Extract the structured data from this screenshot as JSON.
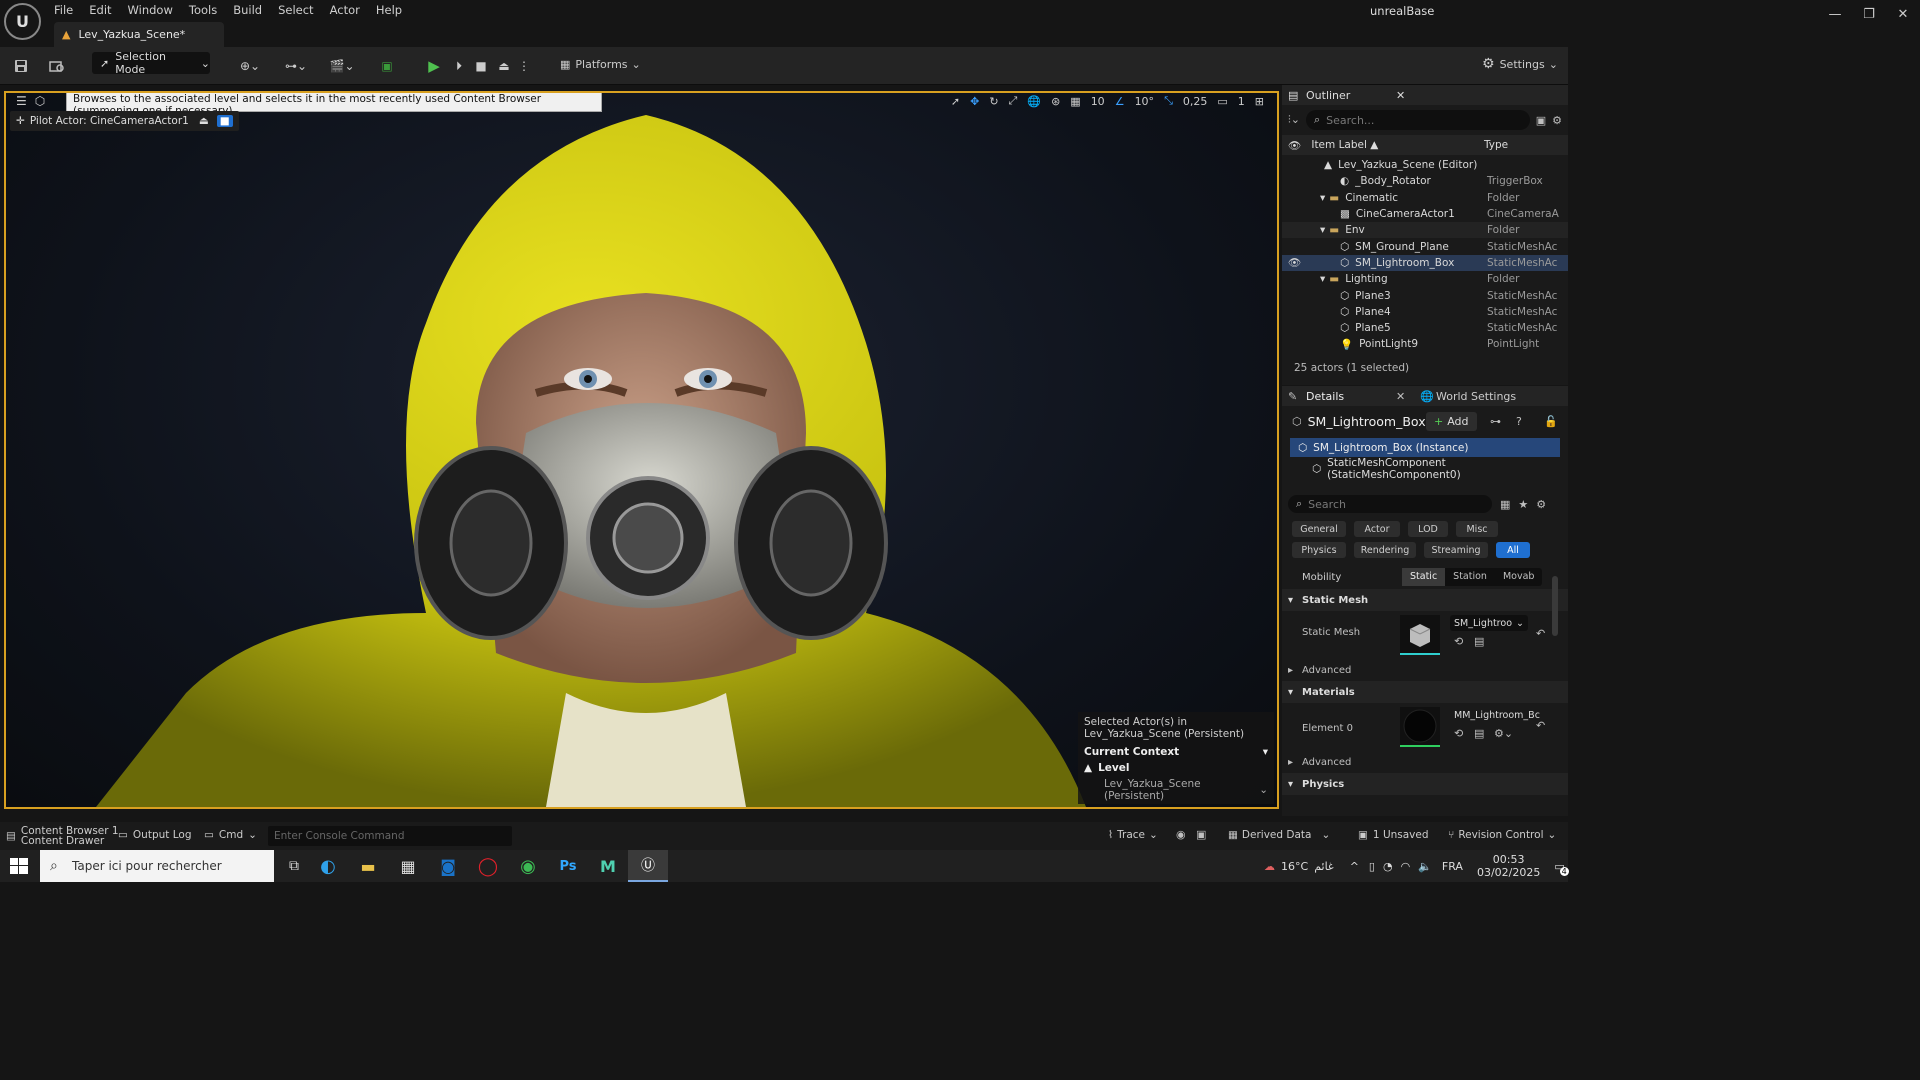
{
  "menu": [
    "File",
    "Edit",
    "Window",
    "Tools",
    "Build",
    "Select",
    "Actor",
    "Help"
  ],
  "tab_title": "Lev_Yazkua_Scene*",
  "project_name": "unrealBase",
  "toolbar": {
    "selection_mode": "Selection Mode",
    "platforms": "Platforms",
    "settings": "Settings"
  },
  "viewport": {
    "tooltip": "Browses to the associated level and selects it in the most recently used Content Browser (summoning one if necessary)",
    "pilot": "Pilot Actor: CineCameraActor1",
    "grid": "10",
    "angle": "10°",
    "scale": "0,25",
    "camera": "1",
    "context": {
      "selected_line1": "Selected Actor(s) in",
      "selected_line2": "Lev_Yazkua_Scene (Persistent)",
      "current_context": "Current Context",
      "level": "Level",
      "level_value": "Lev_Yazkua_Scene (Persistent)"
    }
  },
  "outliner": {
    "title": "Outliner",
    "search_placeholder": "Search...",
    "col_label": "Item Label ▲",
    "col_type": "Type",
    "rows": [
      {
        "label": "Lev_Yazkua_Scene (Editor)",
        "type": ""
      },
      {
        "label": "_Body_Rotator",
        "type": "TriggerBox"
      },
      {
        "label": "Cinematic",
        "type": "Folder"
      },
      {
        "label": "CineCameraActor1",
        "type": "CineCameraA"
      },
      {
        "label": "Env",
        "type": "Folder"
      },
      {
        "label": "SM_Ground_Plane",
        "type": "StaticMeshAc"
      },
      {
        "label": "SM_Lightroom_Box",
        "type": "StaticMeshAc"
      },
      {
        "label": "Lighting",
        "type": "Folder"
      },
      {
        "label": "Plane3",
        "type": "StaticMeshAc"
      },
      {
        "label": "Plane4",
        "type": "StaticMeshAc"
      },
      {
        "label": "Plane5",
        "type": "StaticMeshAc"
      },
      {
        "label": "PointLight9",
        "type": "PointLight"
      }
    ],
    "footer": "25 actors (1 selected)"
  },
  "details": {
    "tab": "Details",
    "world_settings": "World Settings",
    "actor_name": "SM_Lightroom_Box",
    "add": "Add",
    "instance": "SM_Lightroom_Box (Instance)",
    "component": "StaticMeshComponent (StaticMeshComponent0)",
    "search_placeholder": "Search",
    "filters1": [
      "General",
      "Actor",
      "LOD",
      "Misc"
    ],
    "filters2": [
      "Physics",
      "Rendering",
      "Streaming",
      "All"
    ],
    "mobility_label": "Mobility",
    "mobility": [
      "Static",
      "Station",
      "Movab"
    ],
    "section_static_mesh": "Static Mesh",
    "static_mesh_label": "Static Mesh",
    "static_mesh_value": "SM_Lightroo",
    "advanced": "Advanced",
    "section_materials": "Materials",
    "element0": "Element 0",
    "material_value": "MM_Lightroom_Bc",
    "section_physics": "Physics"
  },
  "statusbar": {
    "content_drawer": "Content Drawer",
    "content_browser": "Content Browser 1",
    "output_log": "Output Log",
    "cmd": "Cmd",
    "console_placeholder": "Enter Console Command",
    "trace": "Trace",
    "derived_data": "Derived Data",
    "unsaved": "1 Unsaved",
    "revision_control": "Revision Control"
  },
  "taskbar": {
    "search": "Taper ici pour rechercher",
    "weather": "16°C",
    "weather_text": "غائم",
    "lang": "FRA",
    "time": "00:53",
    "date": "03/02/2025",
    "notif": "4"
  }
}
